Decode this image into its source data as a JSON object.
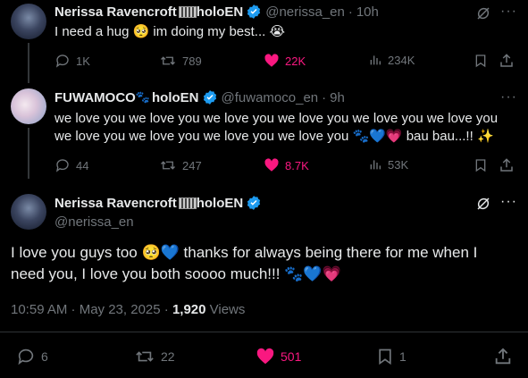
{
  "tweet1": {
    "name": "Nerissa Ravencroft",
    "handle": "@nerissa_en",
    "time": "10h",
    "text": "I need a hug 🥺 im doing my best... 😭",
    "stats": {
      "replies": "1K",
      "retweets": "789",
      "likes": "22K",
      "views": "234K"
    }
  },
  "tweet2": {
    "name": "FUWAMOCO",
    "handle": "@fuwamoco_en",
    "time": "9h",
    "text_line1": "we love you we love you we love you we love you we love you we love you",
    "text_line2": "we love you we love you we love you we love you 🐾💙💗 bau bau...!! ✨",
    "stats": {
      "replies": "44",
      "retweets": "247",
      "likes": "8.7K",
      "views": "53K"
    }
  },
  "tweet3": {
    "name": "Nerissa Ravencroft",
    "handle": "@nerissa_en",
    "text_line1": "I love you guys too 🥺💙 thanks for always being there for me when I",
    "text_line2": "need you, I love you both soooo much!!! 🐾💙💗",
    "timestamp": "10:59 AM · May 23, 2025 · ",
    "views_count": "1,920",
    "views_label": " Views",
    "stats": {
      "replies": "6",
      "retweets": "22",
      "likes": "501",
      "bookmarks": "1"
    }
  },
  "tags": {
    "holoen": "holoEN",
    "dot": "·"
  },
  "colors": {
    "like": "#f91880",
    "verified": "#1d9bf0",
    "muted": "#71767b",
    "text": "#e7e9ea"
  }
}
